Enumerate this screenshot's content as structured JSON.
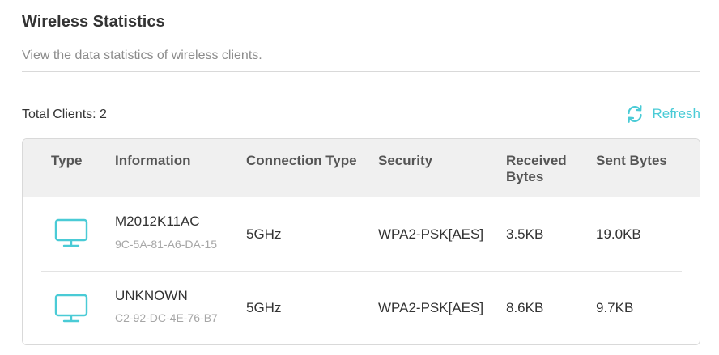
{
  "header": {
    "title": "Wireless Statistics",
    "subtitle": "View the data statistics of wireless clients."
  },
  "summary": {
    "total_clients": "Total Clients: 2",
    "refresh_label": "Refresh",
    "refresh_icon": "refresh-icon"
  },
  "colors": {
    "accent": "#4acbd6",
    "header_bg": "#f0f0f0",
    "muted_text": "#8c8c8c"
  },
  "table": {
    "columns": {
      "type": "Type",
      "information": "Information",
      "connection_type": "Connection Type",
      "security": "Security",
      "received_line1": "Received",
      "received_line2": "Bytes",
      "sent": "Sent Bytes"
    },
    "rows": [
      {
        "type_icon": "desktop-icon",
        "name": "M2012K11AC",
        "mac": "9C-5A-81-A6-DA-15",
        "connection_type": "5GHz",
        "security": "WPA2-PSK[AES]",
        "received": "3.5KB",
        "sent": "19.0KB"
      },
      {
        "type_icon": "desktop-icon",
        "name": "UNKNOWN",
        "mac": "C2-92-DC-4E-76-B7",
        "connection_type": "5GHz",
        "security": "WPA2-PSK[AES]",
        "received": "8.6KB",
        "sent": "9.7KB"
      }
    ]
  }
}
